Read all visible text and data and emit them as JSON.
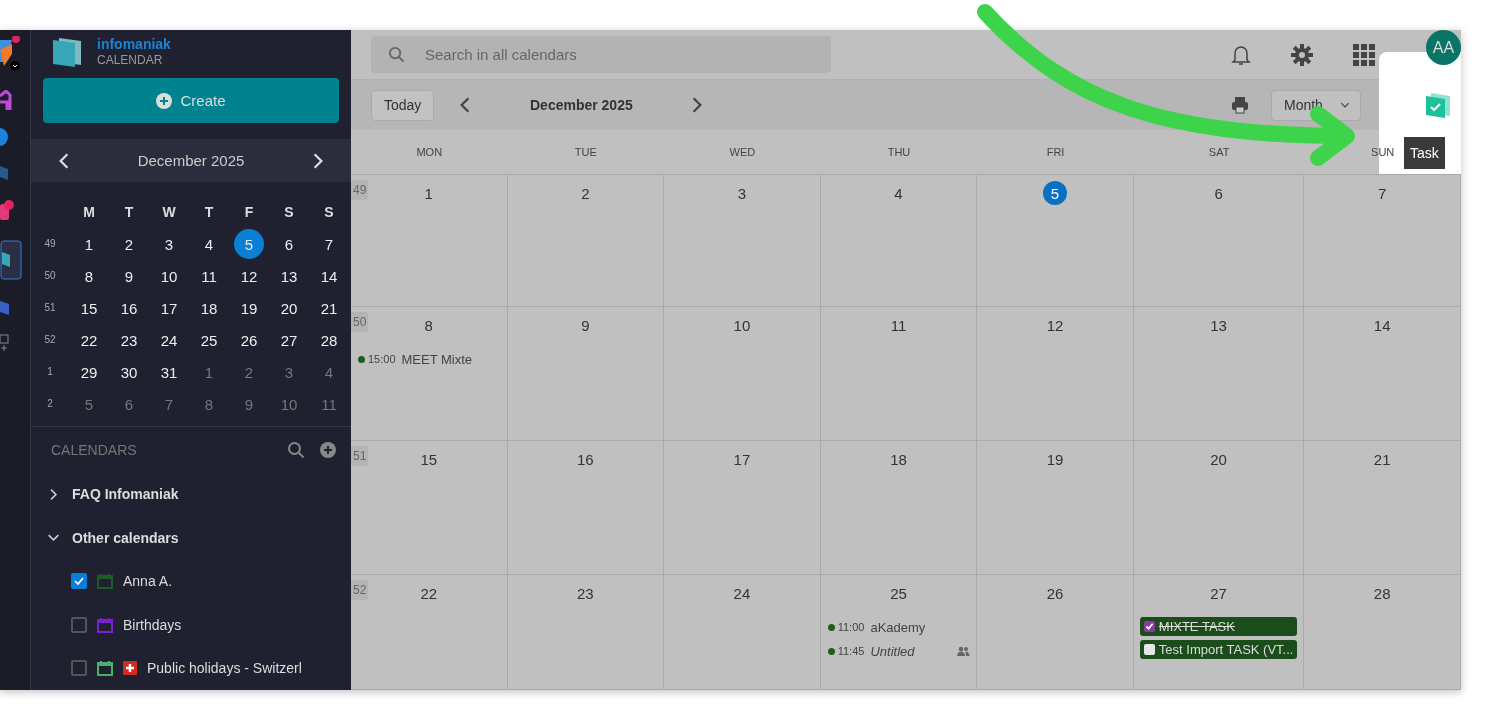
{
  "app": {
    "brand": "infomaniak",
    "product": "CALENDAR"
  },
  "create_button": "Create",
  "mini_calendar": {
    "title": "December 2025",
    "weekdays": [
      "M",
      "T",
      "W",
      "T",
      "F",
      "S",
      "S"
    ],
    "weeks": [
      {
        "number": "49",
        "days": [
          {
            "label": "1",
            "selected": false,
            "outside": false
          },
          {
            "label": "2",
            "selected": false,
            "outside": false
          },
          {
            "label": "3",
            "selected": false,
            "outside": false
          },
          {
            "label": "4",
            "selected": false,
            "outside": false
          },
          {
            "label": "5",
            "selected": true,
            "outside": false
          },
          {
            "label": "6",
            "selected": false,
            "outside": false
          },
          {
            "label": "7",
            "selected": false,
            "outside": false
          }
        ]
      },
      {
        "number": "50",
        "days": [
          {
            "label": "8",
            "selected": false,
            "outside": false
          },
          {
            "label": "9",
            "selected": false,
            "outside": false
          },
          {
            "label": "10",
            "selected": false,
            "outside": false
          },
          {
            "label": "11",
            "selected": false,
            "outside": false
          },
          {
            "label": "12",
            "selected": false,
            "outside": false
          },
          {
            "label": "13",
            "selected": false,
            "outside": false
          },
          {
            "label": "14",
            "selected": false,
            "outside": false
          }
        ]
      },
      {
        "number": "51",
        "days": [
          {
            "label": "15",
            "selected": false,
            "outside": false
          },
          {
            "label": "16",
            "selected": false,
            "outside": false
          },
          {
            "label": "17",
            "selected": false,
            "outside": false
          },
          {
            "label": "18",
            "selected": false,
            "outside": false
          },
          {
            "label": "19",
            "selected": false,
            "outside": false
          },
          {
            "label": "20",
            "selected": false,
            "outside": false
          },
          {
            "label": "21",
            "selected": false,
            "outside": false
          }
        ]
      },
      {
        "number": "52",
        "days": [
          {
            "label": "22",
            "selected": false,
            "outside": false
          },
          {
            "label": "23",
            "selected": false,
            "outside": false
          },
          {
            "label": "24",
            "selected": false,
            "outside": false
          },
          {
            "label": "25",
            "selected": false,
            "outside": false
          },
          {
            "label": "26",
            "selected": false,
            "outside": false
          },
          {
            "label": "27",
            "selected": false,
            "outside": false
          },
          {
            "label": "28",
            "selected": false,
            "outside": false
          }
        ]
      },
      {
        "number": "1",
        "days": [
          {
            "label": "29",
            "selected": false,
            "outside": false
          },
          {
            "label": "30",
            "selected": false,
            "outside": false
          },
          {
            "label": "31",
            "selected": false,
            "outside": false
          },
          {
            "label": "1",
            "selected": false,
            "outside": true
          },
          {
            "label": "2",
            "selected": false,
            "outside": true
          },
          {
            "label": "3",
            "selected": false,
            "outside": true
          },
          {
            "label": "4",
            "selected": false,
            "outside": true
          }
        ]
      },
      {
        "number": "2",
        "days": [
          {
            "label": "5",
            "selected": false,
            "outside": true
          },
          {
            "label": "6",
            "selected": false,
            "outside": true
          },
          {
            "label": "7",
            "selected": false,
            "outside": true
          },
          {
            "label": "8",
            "selected": false,
            "outside": true
          },
          {
            "label": "9",
            "selected": false,
            "outside": true
          },
          {
            "label": "10",
            "selected": false,
            "outside": true
          },
          {
            "label": "11",
            "selected": false,
            "outside": true
          }
        ]
      }
    ]
  },
  "calendars": {
    "heading": "CALENDARS",
    "groups": [
      {
        "name": "FAQ Infomaniak",
        "expanded": false
      },
      {
        "name": "Other calendars",
        "expanded": true,
        "children": [
          {
            "name": "Anna A.",
            "checked": true,
            "color": "#1e5b26",
            "flag": false
          },
          {
            "name": "Birthdays",
            "checked": false,
            "color": "#7a1fd1",
            "flag": false
          },
          {
            "name": "Public holidays - Switzerl",
            "checked": false,
            "color": "#4caf6a",
            "flag": true
          }
        ]
      }
    ]
  },
  "search": {
    "placeholder": "Search in all calendars"
  },
  "avatar": "AA",
  "toolbar": {
    "today": "Today",
    "title": "December 2025",
    "view": "Month",
    "task_tooltip": "Task"
  },
  "month": {
    "weekdays": [
      "MON",
      "TUE",
      "WED",
      "THU",
      "FRI",
      "SAT",
      "SUN"
    ],
    "weeks": [
      {
        "number": "49",
        "days": [
          {
            "label": "1",
            "today": false
          },
          {
            "label": "2",
            "today": false
          },
          {
            "label": "3",
            "today": false
          },
          {
            "label": "4",
            "today": false
          },
          {
            "label": "5",
            "today": true
          },
          {
            "label": "6",
            "today": false
          },
          {
            "label": "7",
            "today": false
          }
        ]
      },
      {
        "number": "50",
        "days": [
          {
            "label": "8",
            "today": false,
            "events": [
              {
                "kind": "event",
                "time": "15:00",
                "title": "MEET Mixte",
                "color": "#1b5e20",
                "italic": false,
                "attendees": false
              }
            ]
          },
          {
            "label": "9",
            "today": false
          },
          {
            "label": "10",
            "today": false
          },
          {
            "label": "11",
            "today": false
          },
          {
            "label": "12",
            "today": false
          },
          {
            "label": "13",
            "today": false
          },
          {
            "label": "14",
            "today": false
          }
        ]
      },
      {
        "number": "51",
        "days": [
          {
            "label": "15",
            "today": false
          },
          {
            "label": "16",
            "today": false
          },
          {
            "label": "17",
            "today": false
          },
          {
            "label": "18",
            "today": false
          },
          {
            "label": "19",
            "today": false
          },
          {
            "label": "20",
            "today": false
          },
          {
            "label": "21",
            "today": false
          }
        ]
      },
      {
        "number": "52",
        "days": [
          {
            "label": "22",
            "today": false
          },
          {
            "label": "23",
            "today": false
          },
          {
            "label": "24",
            "today": false
          },
          {
            "label": "25",
            "today": false,
            "events": [
              {
                "kind": "event",
                "time": "11:00",
                "title": "aKademy",
                "color": "#1b5e20",
                "italic": false,
                "attendees": false
              },
              {
                "kind": "event",
                "time": "11:45",
                "title": "Untitled",
                "color": "#1b5e20",
                "italic": true,
                "attendees": true
              }
            ]
          },
          {
            "label": "26",
            "today": false
          },
          {
            "label": "27",
            "today": false,
            "events": [
              {
                "kind": "task",
                "title": "MIXTE TASK",
                "checked": true,
                "color": "#1b4d1b"
              },
              {
                "kind": "task",
                "title": "Test Import TASK (VT...",
                "checked": false,
                "color": "#1b4d1b"
              }
            ]
          },
          {
            "label": "28",
            "today": false
          }
        ]
      }
    ]
  }
}
